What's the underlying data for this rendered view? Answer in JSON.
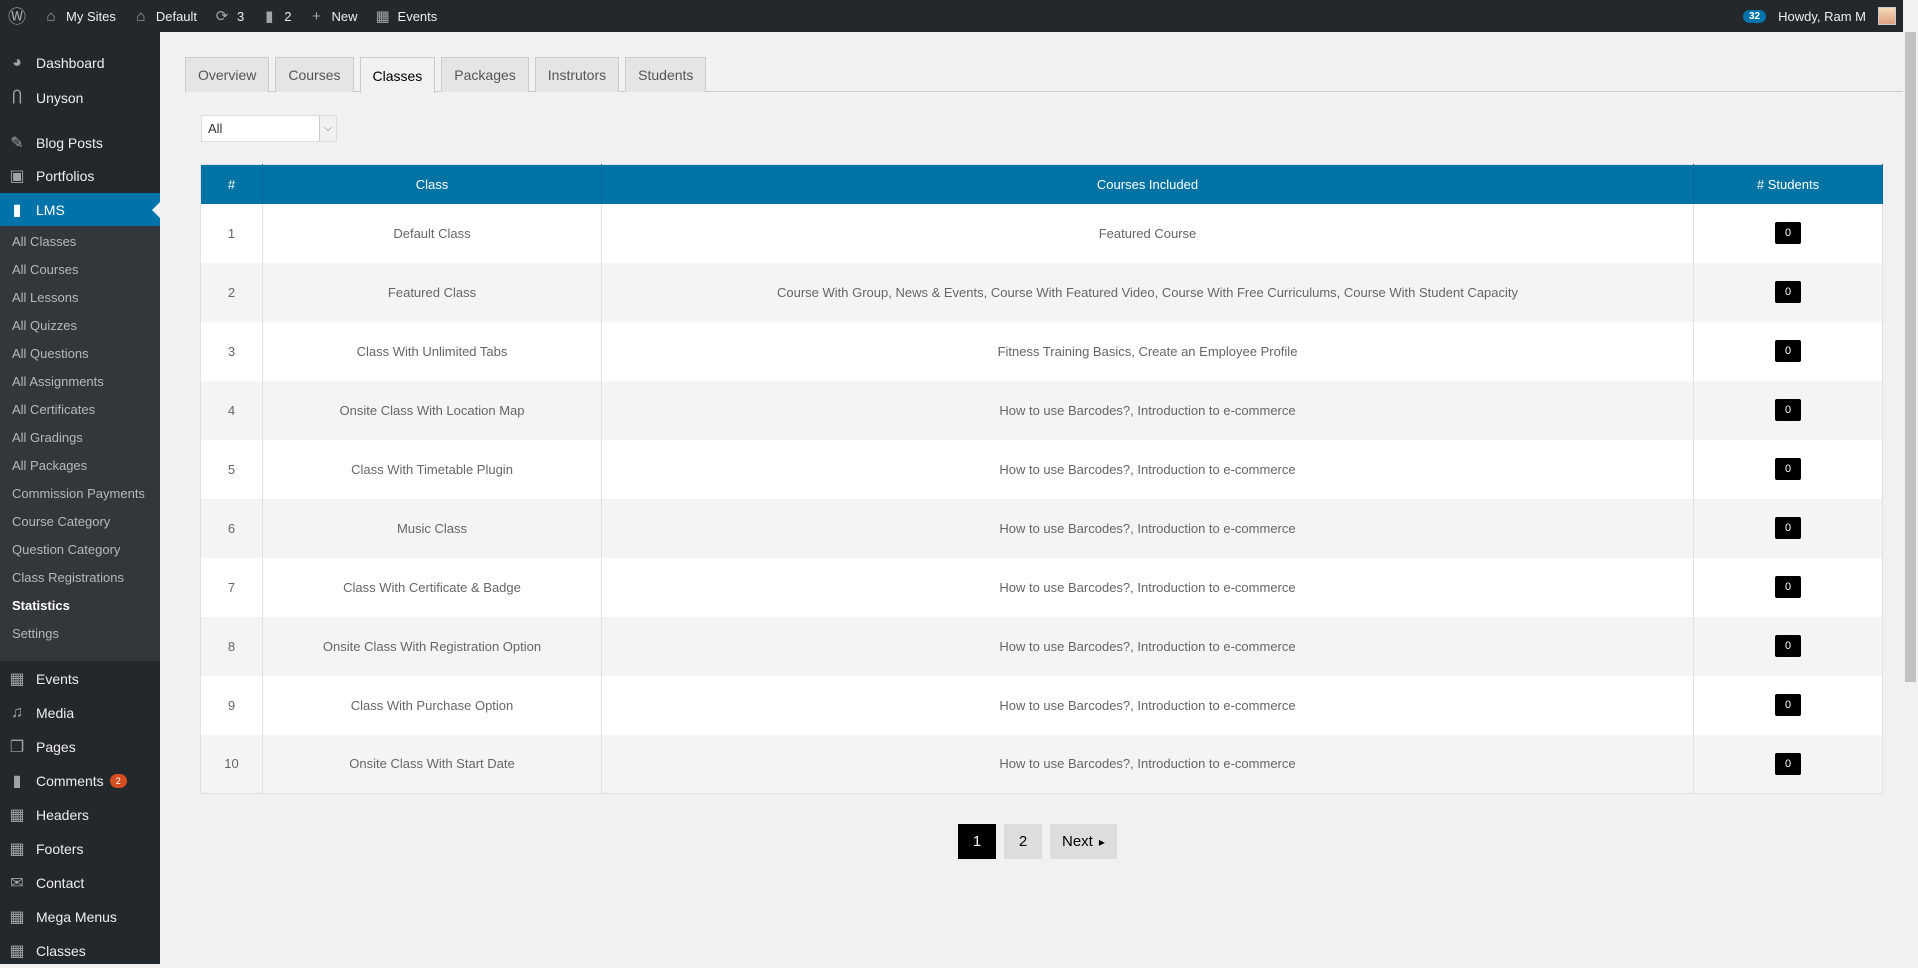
{
  "adminbar": {
    "my_sites": "My Sites",
    "site": "Default",
    "updates": "3",
    "comments": "2",
    "new": "New",
    "events": "Events",
    "notifications": "32",
    "howdy": "Howdy, Ram M"
  },
  "sidebar": {
    "top": [
      {
        "label": "Dashboard",
        "icon": "dashboard-icon"
      },
      {
        "label": "Unyson",
        "icon": "unyson-icon"
      },
      {
        "label": "Blog Posts",
        "icon": "pin-icon"
      },
      {
        "label": "Portfolios",
        "icon": "portfolio-icon"
      },
      {
        "label": "LMS",
        "icon": "book-icon"
      }
    ],
    "lms_sub": [
      "All Classes",
      "All Courses",
      "All Lessons",
      "All Quizzes",
      "All Questions",
      "All Assignments",
      "All Certificates",
      "All Gradings",
      "All Packages",
      "Commission Payments",
      "Course Category",
      "Question Category",
      "Class Registrations",
      "Statistics",
      "Settings"
    ],
    "bottom": [
      {
        "label": "Events",
        "icon": "calendar-icon"
      },
      {
        "label": "Media",
        "icon": "media-icon"
      },
      {
        "label": "Pages",
        "icon": "pages-icon"
      },
      {
        "label": "Comments",
        "icon": "comment-icon",
        "badge": "2"
      },
      {
        "label": "Headers",
        "icon": "grid-icon"
      },
      {
        "label": "Footers",
        "icon": "grid-icon"
      },
      {
        "label": "Contact",
        "icon": "mail-icon"
      },
      {
        "label": "Mega Menus",
        "icon": "grid-icon"
      },
      {
        "label": "Classes",
        "icon": "calendar-icon"
      }
    ]
  },
  "tabs": [
    "Overview",
    "Courses",
    "Classes",
    "Packages",
    "Instrutors",
    "Students"
  ],
  "active_tab": "Classes",
  "filter": {
    "value": "All"
  },
  "table": {
    "headers": [
      "#",
      "Class",
      "Courses Included",
      "# Students"
    ],
    "rows": [
      [
        "1",
        "Default Class",
        "Featured Course",
        "0"
      ],
      [
        "2",
        "Featured Class",
        "Course With Group, News & Events, Course With Featured Video, Course With Free Curriculums, Course With Student Capacity",
        "0"
      ],
      [
        "3",
        "Class With Unlimited Tabs",
        "Fitness Training Basics, Create an Employee Profile",
        "0"
      ],
      [
        "4",
        "Onsite Class With Location Map",
        "How to use Barcodes?, Introduction to e-commerce",
        "0"
      ],
      [
        "5",
        "Class With Timetable Plugin",
        "How to use Barcodes?, Introduction to e-commerce",
        "0"
      ],
      [
        "6",
        "Music Class",
        "How to use Barcodes?, Introduction to e-commerce",
        "0"
      ],
      [
        "7",
        "Class With Certificate & Badge",
        "How to use Barcodes?, Introduction to e-commerce",
        "0"
      ],
      [
        "8",
        "Onsite Class With Registration Option",
        "How to use Barcodes?, Introduction to e-commerce",
        "0"
      ],
      [
        "9",
        "Class With Purchase Option",
        "How to use Barcodes?, Introduction to e-commerce",
        "0"
      ],
      [
        "10",
        "Onsite Class With Start Date",
        "How to use Barcodes?, Introduction to e-commerce",
        "0"
      ]
    ]
  },
  "pagination": {
    "pages": [
      "1",
      "2"
    ],
    "current": "1",
    "next": "Next"
  },
  "colors": {
    "accent": "#0073aa",
    "adminbar": "#23282d",
    "header": "#0073a5"
  }
}
